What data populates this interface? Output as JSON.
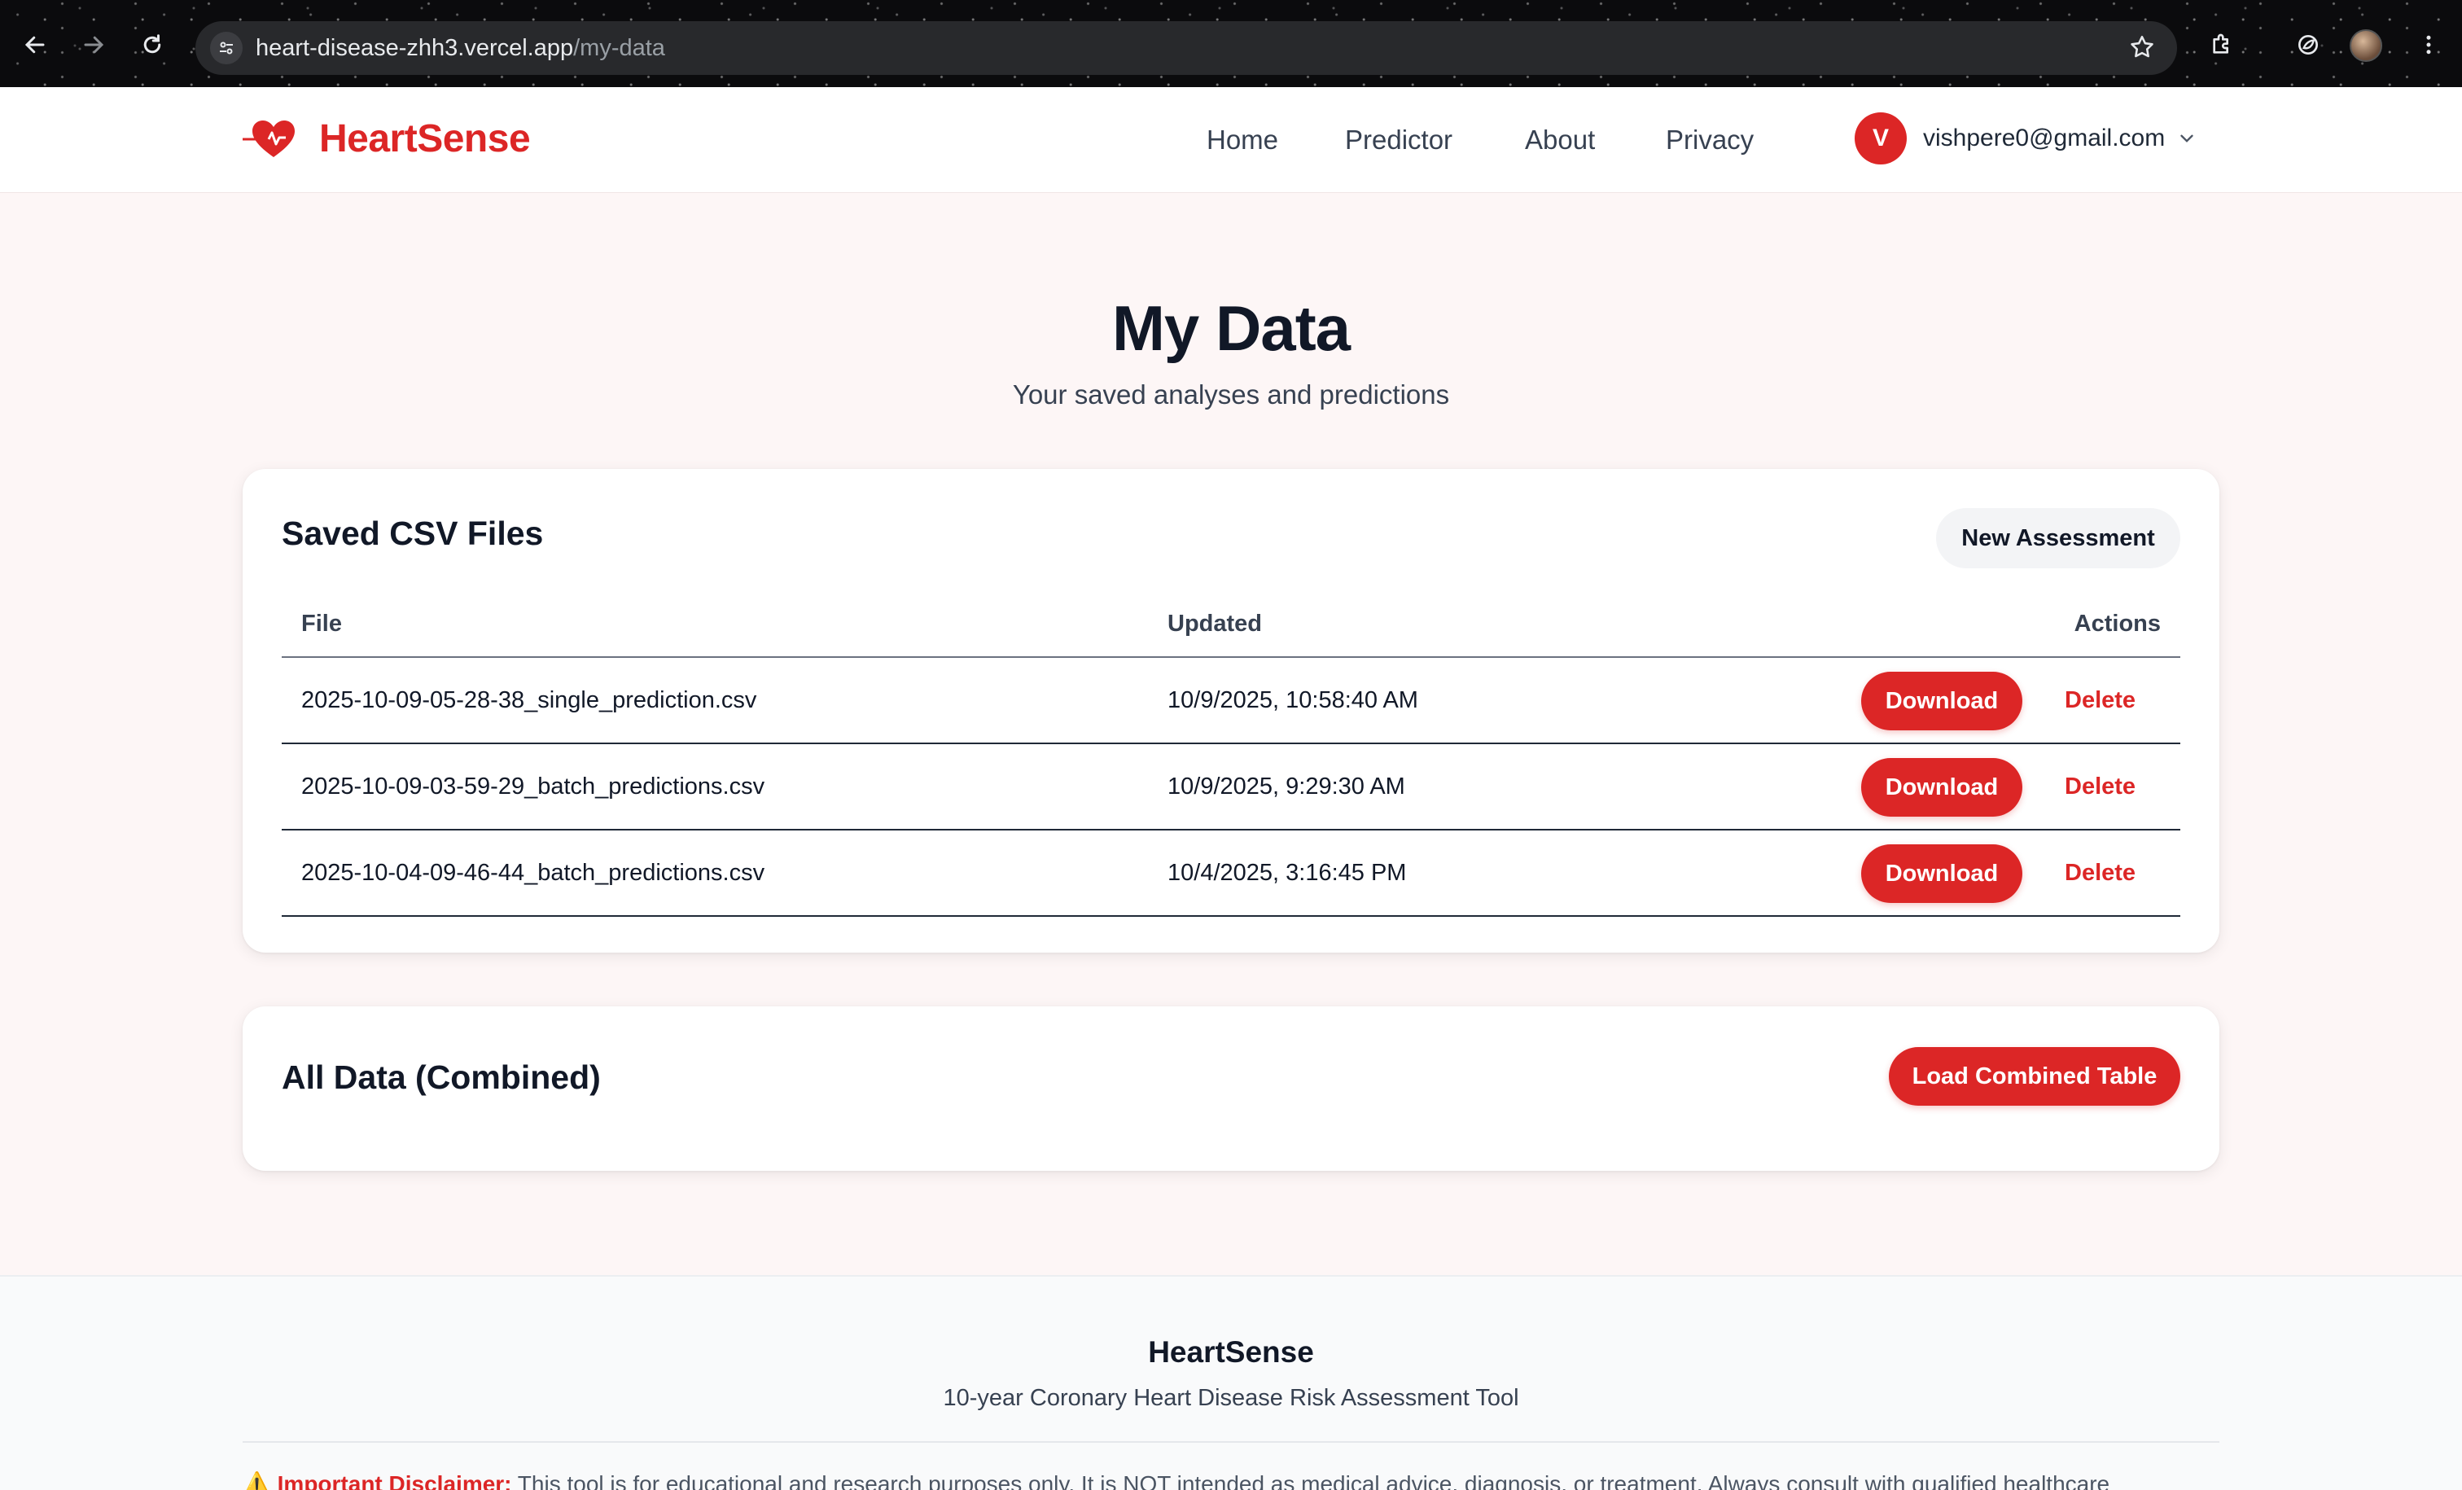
{
  "browser": {
    "url_host": "heart-disease-zhh3.vercel.app",
    "url_path": "/my-data"
  },
  "header": {
    "brand": "HeartSense",
    "nav": [
      "Home",
      "Predictor",
      "About",
      "Privacy"
    ],
    "user_initial": "V",
    "user_email": "vishpere0@gmail.com"
  },
  "main": {
    "title": "My Data",
    "subtitle": "Your saved analyses and predictions"
  },
  "saved_files": {
    "title": "Saved CSV Files",
    "new_button": "New Assessment",
    "columns": [
      "File",
      "Updated",
      "Actions"
    ],
    "download_label": "Download",
    "delete_label": "Delete",
    "rows": [
      {
        "file": "2025-10-09-05-28-38_single_prediction.csv",
        "updated": "10/9/2025, 10:58:40 AM"
      },
      {
        "file": "2025-10-09-03-59-29_batch_predictions.csv",
        "updated": "10/9/2025, 9:29:30 AM"
      },
      {
        "file": "2025-10-04-09-46-44_batch_predictions.csv",
        "updated": "10/4/2025, 3:16:45 PM"
      }
    ]
  },
  "combined": {
    "title": "All Data (Combined)",
    "load_button": "Load Combined Table"
  },
  "footer": {
    "title": "HeartSense",
    "subtitle": "10-year Coronary Heart Disease Risk Assessment Tool",
    "disclaimer_label": "Important Disclaimer:",
    "disclaimer_text": "This tool is for educational and research purposes only. It is NOT intended as medical advice, diagnosis, or treatment. Always consult with qualified healthcare"
  },
  "colors": {
    "brand_red": "#dc2626",
    "page_bg": "#fdf6f6"
  }
}
